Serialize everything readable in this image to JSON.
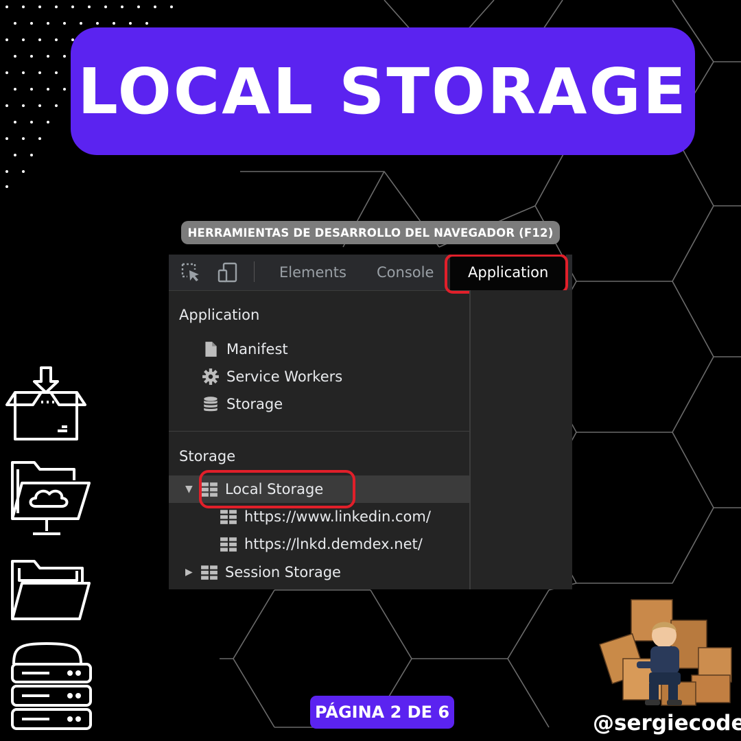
{
  "title": "LOCAL STORAGE",
  "subtitle": "HERRAMIENTAS DE DESARROLLO DEL NAVEGADOR (F12)",
  "devtools": {
    "tabs": [
      "Elements",
      "Console",
      "Application"
    ],
    "active_tab": "Application",
    "application_section": {
      "heading": "Application",
      "items": [
        "Manifest",
        "Service Workers",
        "Storage"
      ]
    },
    "storage_section": {
      "heading": "Storage",
      "local_storage": "Local Storage",
      "local_children": [
        "https://www.linkedin.com/",
        "https://lnkd.demdex.net/"
      ],
      "session_storage": "Session Storage"
    },
    "icons": [
      "inspect-icon",
      "device-toggle-icon",
      "file-icon",
      "gear-icon",
      "database-icon",
      "grid-icon"
    ]
  },
  "page_indicator": "PÁGINA 2 DE 6",
  "handle": "@sergiecode",
  "colors": {
    "accent": "#5b23f0",
    "highlight": "#e01f2a",
    "panel": "#242424",
    "background": "#000000"
  },
  "side_icons": [
    "package-download-icon",
    "cloud-folder-monitor-icon",
    "open-folder-icon",
    "server-icon"
  ]
}
